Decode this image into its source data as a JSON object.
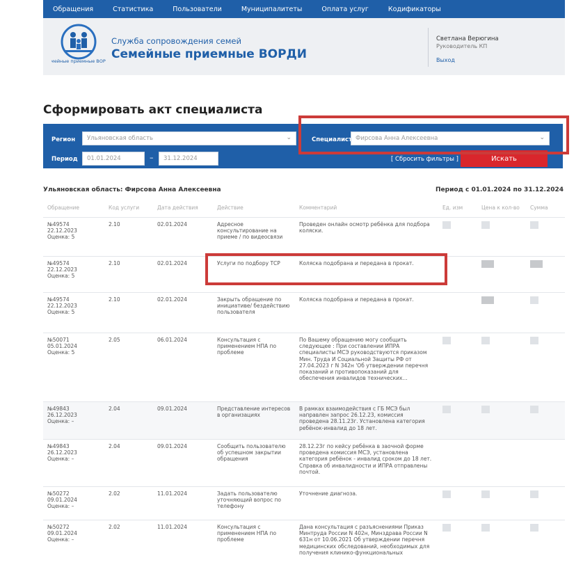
{
  "nav": {
    "items": [
      "Обращения",
      "Статистика",
      "Пользователи",
      "Муниципалитеты",
      "Оплата услуг",
      "Кодификаторы"
    ]
  },
  "header": {
    "logo_caption": "Семейные приемные ВОРДИ",
    "subtitle": "Служба сопровождения семей",
    "title": "Семейные приемные ВОРДИ",
    "user_name": "Светлана Верюгина",
    "user_role": "Руководитель КП",
    "logout": "Выход"
  },
  "page_title": "Сформировать акт специалиста",
  "filter": {
    "region_label": "Регион",
    "region_value": "Ульяновская область",
    "specialist_label": "Специалист",
    "specialist_value": "Фирсова Анна Алексеевна",
    "period_label": "Период",
    "date_from": "01.01.2024",
    "date_to": "31.12.2024",
    "dash": "–",
    "reset_label": "[ Сбросить фильтры ]",
    "search_label": "Искать"
  },
  "results": {
    "title": "Ульяновская область: Фирсова Анна Алексеевна",
    "period": "Период с 01.01.2024 по 31.12.2024",
    "columns": [
      "Обращение",
      "Код услуги",
      "Дата действия",
      "Действие",
      "Комментарий",
      "Ед. изм",
      "Цена к кол-во",
      "Сумма"
    ],
    "rows": [
      {
        "num": "№49574",
        "date": "22.12.2023",
        "score": "Оценка: 5",
        "code": "2.10",
        "action_date": "02.01.2024",
        "action": "Адресное консультирование на приеме / по видеосвязи",
        "comment": "Проведен онлайн осмотр ребёнка для подбора коляски."
      },
      {
        "num": "№49574",
        "date": "22.12.2023",
        "score": "Оценка: 5",
        "code": "2.10",
        "action_date": "02.01.2024",
        "action": "Услуги по подбору ТСР",
        "comment": "Коляска подобрана и передана в прокат."
      },
      {
        "num": "№49574",
        "date": "22.12.2023",
        "score": "Оценка: 5",
        "code": "2.10",
        "action_date": "02.01.2024",
        "action": "Закрыть обращение по инициативе/ бездействию пользователя",
        "comment": "Коляска подобрана и передана в прокат."
      },
      {
        "num": "№50071",
        "date": "05.01.2024",
        "score": "Оценка: 5",
        "code": "2.05",
        "action_date": "06.01.2024",
        "action": "Консультация с применением НПА по проблеме",
        "comment": "По Вашему обращению могу сообщить следующее : При составлении ИПРА специалисты МСЭ руководствуются приказом Мин. Труда И Социальной Защиты РФ от 27.04.2023 г N 342н 'Об утверждении перечня показаний и противопоказаний для обеспечения инвалидов технических..."
      },
      {
        "num": "№49843",
        "date": "26.12.2023",
        "score": "Оценка: –",
        "code": "2.04",
        "action_date": "09.01.2024",
        "action": "Представление интересов в организациях",
        "comment": "В рамках взаимодействия с ГБ МСЭ был направлен запрос 26.12.23, комиссия проведена 28.11.23г. Установлена категория ребёнок-инвалид до 18 лет."
      },
      {
        "num": "№49843",
        "date": "26.12.2023",
        "score": "Оценка: –",
        "code": "2.04",
        "action_date": "09.01.2024",
        "action": "Сообщить пользователю об успешном закрытии обращения",
        "comment": "28.12.23г по кейсу ребёнка в заочной форме проведена комиссия МСЭ, установлена категория ребёнок - инвалид сроком до 18 лет. Справка об инвалидности и ИПРА отправлены почтой."
      },
      {
        "num": "№50272",
        "date": "09.01.2024",
        "score": "Оценка: –",
        "code": "2.02",
        "action_date": "11.01.2024",
        "action": "Задать пользователю уточняющий вопрос по телефону",
        "comment": "Уточнение диагноза."
      },
      {
        "num": "№50272",
        "date": "09.01.2024",
        "score": "Оценка: –",
        "code": "2.02",
        "action_date": "11.01.2024",
        "action": "Консультация с применением НПА по проблеме",
        "comment": "Дана консультация с разъяснениями Приказ Минтруда России N 402н, Минздрава России N 631н от 10.06.2021 Об утверждении перечня медицинских обследований, необходимых для получения клинико-функциональных"
      }
    ]
  },
  "colors": {
    "primary": "#1f5fa8",
    "search": "#d9262c",
    "highlight": "#cc3b39"
  }
}
